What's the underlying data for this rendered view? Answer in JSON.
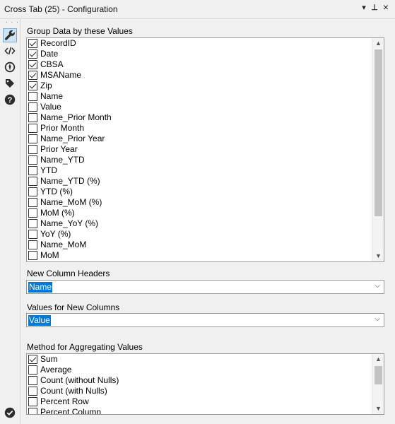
{
  "window": {
    "title": "Cross Tab (25) - Configuration",
    "menu_glyph": "▾",
    "pin_glyph": "⊥",
    "close_glyph": "×"
  },
  "leftbar": {
    "dots": "· · ·",
    "icons": [
      "wrench-icon",
      "code-icon",
      "globe-icon",
      "tag-icon",
      "help-icon"
    ],
    "bottom_icon": "checkmark-circle-icon"
  },
  "group_by": {
    "label": "Group Data by these Values",
    "items": [
      {
        "label": "RecordID",
        "checked": true
      },
      {
        "label": "Date",
        "checked": true
      },
      {
        "label": "CBSA",
        "checked": true
      },
      {
        "label": "MSAName",
        "checked": true
      },
      {
        "label": "Zip",
        "checked": true
      },
      {
        "label": "Name",
        "checked": false
      },
      {
        "label": "Value",
        "checked": false
      },
      {
        "label": "Name_Prior Month",
        "checked": false
      },
      {
        "label": "Prior Month",
        "checked": false
      },
      {
        "label": "Name_Prior Year",
        "checked": false
      },
      {
        "label": "Prior Year",
        "checked": false
      },
      {
        "label": "Name_YTD",
        "checked": false
      },
      {
        "label": "YTD",
        "checked": false
      },
      {
        "label": "Name_YTD (%)",
        "checked": false
      },
      {
        "label": "YTD (%)",
        "checked": false
      },
      {
        "label": "Name_MoM (%)",
        "checked": false
      },
      {
        "label": "MoM (%)",
        "checked": false
      },
      {
        "label": "Name_YoY (%)",
        "checked": false
      },
      {
        "label": "YoY (%)",
        "checked": false
      },
      {
        "label": "Name_MoM",
        "checked": false
      },
      {
        "label": "MoM",
        "checked": false
      }
    ]
  },
  "new_column_headers": {
    "label": "New Column Headers",
    "value": "Name"
  },
  "values_for_new_columns": {
    "label": "Values for New Columns",
    "value": "Value"
  },
  "aggregation": {
    "label": "Method for Aggregating Values",
    "items": [
      {
        "label": "Sum",
        "checked": true
      },
      {
        "label": "Average",
        "checked": false
      },
      {
        "label": "Count (without Nulls)",
        "checked": false
      },
      {
        "label": "Count (with Nulls)",
        "checked": false
      },
      {
        "label": "Percent Row",
        "checked": false
      },
      {
        "label": "Percent Column",
        "checked": false
      }
    ]
  },
  "colors": {
    "accent": "#0078d7",
    "active_icon_bg": "#cfe3f6",
    "icon": "#2d2d2d"
  }
}
